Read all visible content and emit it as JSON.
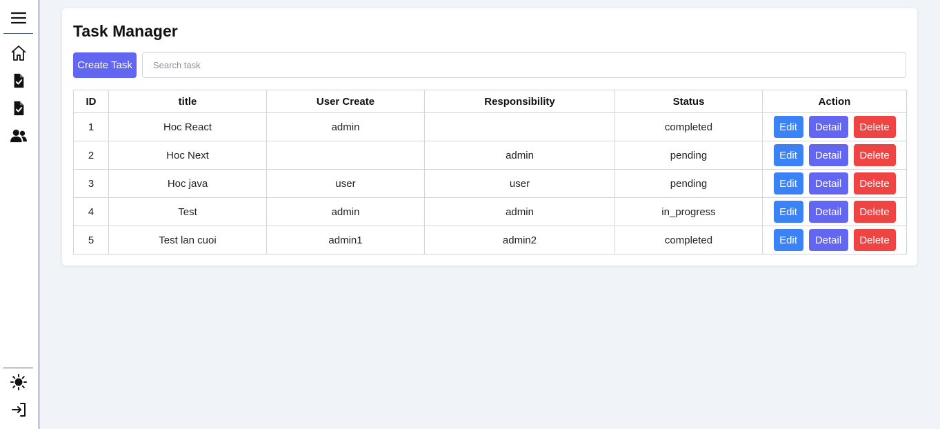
{
  "sidebar": {
    "top_items": [
      {
        "name": "menu-icon"
      },
      {
        "name": "home-icon"
      },
      {
        "name": "task-document-icon"
      },
      {
        "name": "task-check-document-icon"
      },
      {
        "name": "users-icon"
      }
    ],
    "bottom_items": [
      {
        "name": "sun-theme-icon"
      },
      {
        "name": "logout-icon"
      }
    ]
  },
  "page": {
    "title": "Task Manager",
    "create_label": "Create Task",
    "search_placeholder": "Search task",
    "search_value": ""
  },
  "table": {
    "headers": [
      "ID",
      "title",
      "User Create",
      "Responsibility",
      "Status",
      "Action"
    ],
    "rows": [
      {
        "id": "1",
        "title": "Hoc React",
        "user_create": "admin",
        "responsibility": "",
        "status": "completed"
      },
      {
        "id": "2",
        "title": "Hoc Next",
        "user_create": "",
        "responsibility": "admin",
        "status": "pending"
      },
      {
        "id": "3",
        "title": "Hoc java",
        "user_create": "user",
        "responsibility": "user",
        "status": "pending"
      },
      {
        "id": "4",
        "title": "Test",
        "user_create": "admin",
        "responsibility": "admin",
        "status": "in_progress"
      },
      {
        "id": "5",
        "title": "Test lan cuoi",
        "user_create": "admin1",
        "responsibility": "admin2",
        "status": "completed"
      }
    ],
    "action_labels": {
      "edit": "Edit",
      "detail": "Detail",
      "delete": "Delete"
    }
  },
  "colors": {
    "primary": "#6366f1",
    "edit": "#3b82f6",
    "delete": "#ef4444",
    "background": "#f0f3f8"
  }
}
